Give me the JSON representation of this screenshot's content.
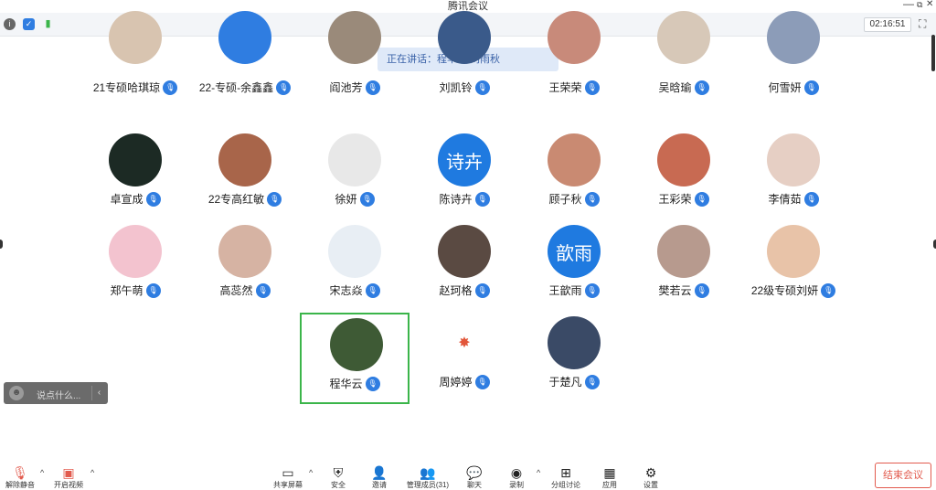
{
  "window": {
    "title": "腾讯会议",
    "minimize": "—",
    "restore": "⧉",
    "close": "✕"
  },
  "infobar": {
    "timer": "02:16:51",
    "fullscreen_glyph": "⛶"
  },
  "speaking": {
    "text": "正在讲话：程华云 刘雨秋"
  },
  "participants": [
    {
      "name": "21专硕哈琪琼",
      "avatar_text": "",
      "color": "#d8c4b0",
      "partial": true
    },
    {
      "name": "22-专硕-余鑫鑫",
      "avatar_text": "",
      "color": "#2f7de1",
      "partial": true
    },
    {
      "name": "阎池芳",
      "avatar_text": "",
      "color": "#9a8a7a",
      "partial": true
    },
    {
      "name": "刘凯铃",
      "avatar_text": "",
      "color": "#3a5a8a",
      "partial": true
    },
    {
      "name": "王荣荣",
      "avatar_text": "",
      "color": "#c88a7a",
      "partial": true
    },
    {
      "name": "吴晗瑜",
      "avatar_text": "",
      "color": "#d7c8b8",
      "partial": true
    },
    {
      "name": "何雪妍",
      "avatar_text": "",
      "color": "#8c9cb8",
      "partial": true
    },
    {
      "name": "卓宣成",
      "avatar_text": "",
      "color": "#1c2a24"
    },
    {
      "name": "22专高红敏",
      "avatar_text": "",
      "color": "#a8654a"
    },
    {
      "name": "徐妍",
      "avatar_text": "",
      "color": "#e8e8e8"
    },
    {
      "name": "陈诗卉",
      "avatar_text": "诗卉",
      "color": "#1f7ae0"
    },
    {
      "name": "顾子秋",
      "avatar_text": "",
      "color": "#c98a72"
    },
    {
      "name": "王彩荣",
      "avatar_text": "",
      "color": "#c86a52"
    },
    {
      "name": "李倩茹",
      "avatar_text": "",
      "color": "#e6cfc4"
    },
    {
      "name": "郑午萌",
      "avatar_text": "",
      "color": "#f3c3cf"
    },
    {
      "name": "高蕊然",
      "avatar_text": "",
      "color": "#d6b3a3"
    },
    {
      "name": "宋志焱",
      "avatar_text": "",
      "color": "#e8eef4"
    },
    {
      "name": "赵珂格",
      "avatar_text": "",
      "color": "#5a4a42"
    },
    {
      "name": "王歆雨",
      "avatar_text": "歆雨",
      "color": "#1f7ae0"
    },
    {
      "name": "樊若云",
      "avatar_text": "",
      "color": "#b79a8e"
    },
    {
      "name": "22级专硕刘妍",
      "avatar_text": "",
      "color": "#e8c3a8"
    },
    {
      "name": "程华云",
      "avatar_text": "",
      "color": "#3e5a35",
      "active": true
    },
    {
      "name": "周婷婷",
      "avatar_text": "✸",
      "color": "#ffffff"
    },
    {
      "name": "于楚凡",
      "avatar_text": "",
      "color": "#3a4a66"
    }
  ],
  "chat": {
    "placeholder": "说点什么...",
    "emoji": "☻",
    "collapse": "‹"
  },
  "toolbar": {
    "mute": "解除静音",
    "video": "开启视频",
    "share": "共享屏幕",
    "security": "安全",
    "invite": "邀请",
    "members": "管理成员(31)",
    "chat": "聊天",
    "record": "录制",
    "breakout": "分组讨论",
    "apps": "应用",
    "settings": "设置",
    "end": "结束会议"
  },
  "colors": {
    "accent": "#2f7de1",
    "end": "#e25b4e",
    "active_border": "#3bb54a"
  }
}
